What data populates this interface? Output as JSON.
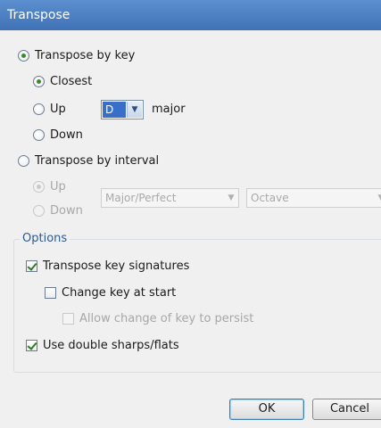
{
  "window": {
    "title": "Transpose"
  },
  "by_key": {
    "label": "Transpose by key",
    "closest_label": "Closest",
    "up_label": "Up",
    "down_label": "Down",
    "key_value": "D",
    "mode_label": "major"
  },
  "by_interval": {
    "label": "Transpose by interval",
    "up_label": "Up",
    "down_label": "Down",
    "quality_value": "Major/Perfect",
    "interval_value": "Octave"
  },
  "options": {
    "label": "Options",
    "transpose_key_signatures": "Transpose key signatures",
    "change_key_at_start": "Change key at start",
    "allow_change_persist": "Allow change of key to persist",
    "double_sharps_flats": "Use double sharps/flats"
  },
  "buttons": {
    "ok": "OK",
    "cancel": "Cancel"
  },
  "colors": {
    "titlebar": "#4a7fc1",
    "group_label": "#2b5a96",
    "selection": "#3a6fc9"
  },
  "icons": {
    "dropdown": "chevron-down-icon"
  }
}
